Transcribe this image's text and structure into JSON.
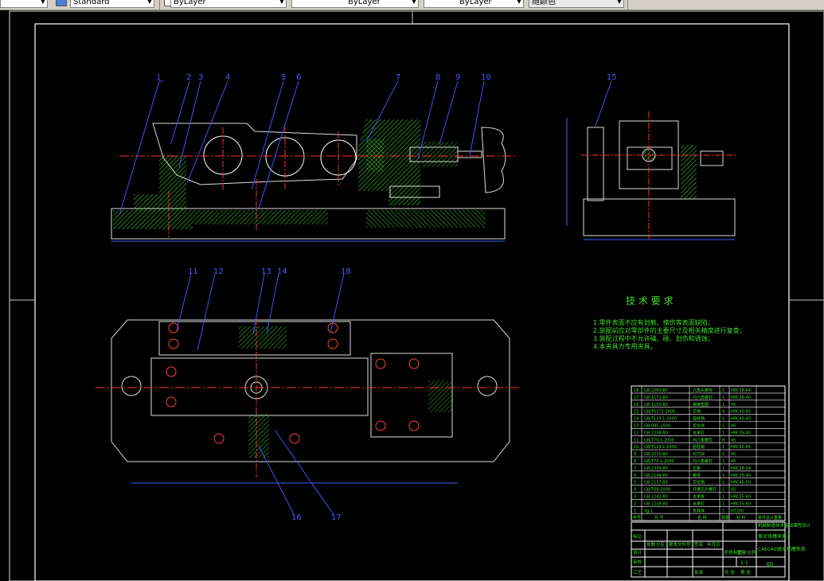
{
  "toolbar": {
    "layer_label": "Standard",
    "linetype_label": "ByLayer",
    "lineweight_label": "ByLayer",
    "plotstyle_label": "ByLayer",
    "color_label": "随颜色"
  },
  "drawing": {
    "tech_title": "技 术 要 求",
    "tech_notes": [
      "1.零件表面不应有划痕、擦伤等表面缺陷；",
      "2.装配前应对零部件的主要尺寸及相关精度进行复查；",
      "3.装配过程中不允许磕、碰、划伤和锈蚀；",
      "4.本夹具为专用夹具。"
    ],
    "part_labels_top": [
      "1",
      "2",
      "3",
      "4",
      "5",
      "6",
      "7",
      "8",
      "9",
      "10"
    ],
    "part_label_side": "15",
    "part_labels_plan": [
      "11",
      "12",
      "13",
      "14",
      "18",
      "16",
      "17"
    ],
    "bom_rows": [
      {
        "no": "18",
        "std": "GB 2260-80",
        "name": "六角头螺栓",
        "qty": "1",
        "mat": "HRC58-64"
      },
      {
        "no": "17",
        "std": "GB 1171-80",
        "name": "内六角螺钉",
        "qty": "1",
        "mat": "HRC36-40"
      },
      {
        "no": "16",
        "std": "GB 1150-80",
        "name": "弹簧垫圈",
        "qty": "1",
        "mat": "45"
      },
      {
        "no": "15",
        "std": "GB/T6172-2000",
        "name": "手柄",
        "qty": "4",
        "mat": "HRC40-45"
      },
      {
        "no": "14",
        "std": "GB/T119.1-2000",
        "name": "圆柱销",
        "qty": "1",
        "mat": "HRC40-45"
      },
      {
        "no": "13",
        "std": "GB 985-1000",
        "name": "定位块",
        "qty": "1",
        "mat": "45"
      },
      {
        "no": "12",
        "std": "GB 2238-80",
        "name": "支承钉",
        "qty": "1",
        "mat": "HRC35-40"
      },
      {
        "no": "11",
        "std": "GB/T70.1-2000",
        "name": "内六角螺钉",
        "qty": "8",
        "mat": "45"
      },
      {
        "no": "10",
        "std": "GB/T119.1-2000",
        "name": "圆柱销",
        "qty": "1",
        "mat": "HRC40-45"
      },
      {
        "no": "9",
        "std": "GB 2210-80",
        "name": "对刀块",
        "qty": "1",
        "mat": "45"
      },
      {
        "no": "8",
        "std": "GB/T70.1-2000",
        "name": "内六角螺钉",
        "qty": "1",
        "mat": "45"
      },
      {
        "no": "7",
        "std": "GB 2339-80",
        "name": "压板",
        "qty": "1",
        "mat": "HRC28-34"
      },
      {
        "no": "6",
        "std": "GB 2148-80",
        "name": "螺母",
        "qty": "1",
        "mat": "HRC35-40"
      },
      {
        "no": "5",
        "std": "GB 2157-80",
        "name": "定位销",
        "qty": "1",
        "mat": "HRC40-50"
      },
      {
        "no": "4",
        "std": "GB/T68-2000",
        "name": "开槽沉头螺钉",
        "qty": "1",
        "mat": "45"
      },
      {
        "no": "3",
        "std": "GB 2242-80",
        "name": "支承板",
        "qty": "1",
        "mat": "HRC55-60"
      },
      {
        "no": "2",
        "std": "GB 2238-80",
        "name": "支承钉",
        "qty": "1",
        "mat": "HRC55-60"
      },
      {
        "no": "1",
        "std": "XJJ-1",
        "name": "夹具体",
        "qty": "1",
        "mat": "HT200"
      }
    ],
    "bom_header": {
      "no": "序号",
      "std": "代 号",
      "name": "名 称",
      "qty": "数量",
      "mat": "材 料",
      "note": "单件总计重量"
    },
    "title_block": {
      "school": "机械制造技术基础课程设计",
      "subtitle": "拨叉铣槽夹具",
      "part_name": "CA6140拨叉铣槽夹具",
      "drawing_no": "XJJ",
      "scale": "1:1",
      "row_labels": [
        "标记",
        "设计",
        "审核",
        "工艺"
      ],
      "col_labels": [
        "处数",
        "分区",
        "更改文件号",
        "签名",
        "年月日"
      ],
      "stage_labels": [
        "阶段标记",
        "重量",
        "比例"
      ],
      "sheet_labels": [
        "共 张",
        "第 张"
      ],
      "approve_label": "批准"
    }
  }
}
